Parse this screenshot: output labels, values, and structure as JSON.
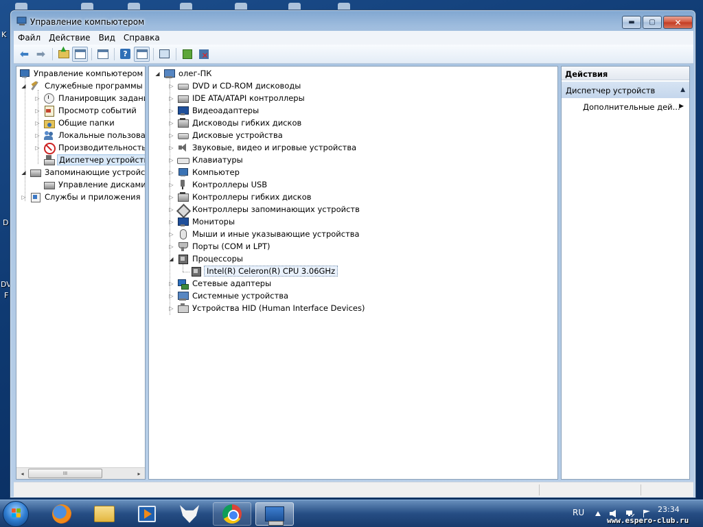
{
  "desktop": {
    "left_edge_labels": [
      "K",
      "D",
      "DV",
      "F"
    ]
  },
  "window": {
    "title": "Управление компьютером",
    "controls": {
      "minimize": "▬",
      "maximize": "▢",
      "close": "✕"
    }
  },
  "menubar": {
    "items": [
      "Файл",
      "Действие",
      "Вид",
      "Справка"
    ]
  },
  "toolbar": {
    "buttons": [
      "back-icon",
      "forward-icon",
      "up-folder-icon",
      "show-hide-tree-icon",
      "properties-icon",
      "help-icon",
      "show-hide-action-pane-icon",
      "scan-hardware-icon",
      "update-driver-icon",
      "uninstall-device-icon"
    ],
    "help_label": "?"
  },
  "left_tree": {
    "items": [
      {
        "label": "Управление компьютером (л",
        "level": 0,
        "expander": "",
        "icon": "computer-management-icon"
      },
      {
        "label": "Служебные программы",
        "level": 1,
        "expander": "◢",
        "icon": "tools-icon"
      },
      {
        "label": "Планировщик заданий",
        "level": 2,
        "expander": "▷",
        "icon": "clock-icon"
      },
      {
        "label": "Просмотр событий",
        "level": 2,
        "expander": "▷",
        "icon": "event-viewer-icon"
      },
      {
        "label": "Общие папки",
        "level": 2,
        "expander": "▷",
        "icon": "shared-folders-icon"
      },
      {
        "label": "Локальные пользовате",
        "level": 2,
        "expander": "▷",
        "icon": "users-icon"
      },
      {
        "label": "Производительность",
        "level": 2,
        "expander": "▷",
        "icon": "performance-icon"
      },
      {
        "label": "Диспетчер устройств",
        "level": 2,
        "expander": "",
        "icon": "device-manager-icon",
        "selected": true
      },
      {
        "label": "Запоминающие устройст",
        "level": 1,
        "expander": "◢",
        "icon": "storage-icon"
      },
      {
        "label": "Управление дисками",
        "level": 2,
        "expander": "",
        "icon": "disk-management-icon"
      },
      {
        "label": "Службы и приложения",
        "level": 1,
        "expander": "▷",
        "icon": "services-icon"
      }
    ],
    "scrollbar_grip": "III",
    "scroll_left": "◂",
    "scroll_right": "▸"
  },
  "device_tree": {
    "root": "олег-ПК",
    "categories": [
      {
        "label": "DVD и CD-ROM дисководы",
        "icon": "dvd-drive-icon",
        "expanded": false
      },
      {
        "label": "IDE ATA/ATAPI контроллеры",
        "icon": "ide-controller-icon",
        "expanded": false
      },
      {
        "label": "Видеоадаптеры",
        "icon": "display-adapter-icon",
        "expanded": false
      },
      {
        "label": "Дисководы гибких дисков",
        "icon": "floppy-drive-icon",
        "expanded": false
      },
      {
        "label": "Дисковые устройства",
        "icon": "disk-drive-icon",
        "expanded": false
      },
      {
        "label": "Звуковые, видео и игровые устройства",
        "icon": "sound-icon",
        "expanded": false
      },
      {
        "label": "Клавиатуры",
        "icon": "keyboard-icon",
        "expanded": false
      },
      {
        "label": "Компьютер",
        "icon": "computer-icon",
        "expanded": false
      },
      {
        "label": "Контроллеры USB",
        "icon": "usb-icon",
        "expanded": false
      },
      {
        "label": "Контроллеры гибких дисков",
        "icon": "floppy-controller-icon",
        "expanded": false
      },
      {
        "label": "Контроллеры запоминающих устройств",
        "icon": "storage-controller-icon",
        "expanded": false
      },
      {
        "label": "Мониторы",
        "icon": "monitor-icon",
        "expanded": false
      },
      {
        "label": "Мыши и иные указывающие устройства",
        "icon": "mouse-icon",
        "expanded": false
      },
      {
        "label": "Порты (COM и LPT)",
        "icon": "port-icon",
        "expanded": false
      },
      {
        "label": "Процессоры",
        "icon": "processor-icon",
        "expanded": true,
        "children": [
          "Intel(R) Celeron(R) CPU 3.06GHz"
        ]
      },
      {
        "label": "Сетевые адаптеры",
        "icon": "network-adapter-icon",
        "expanded": false
      },
      {
        "label": "Системные устройства",
        "icon": "system-devices-icon",
        "expanded": false
      },
      {
        "label": "Устройства HID (Human Interface Devices)",
        "icon": "hid-icon",
        "expanded": false
      }
    ],
    "expander_closed": "▷",
    "expander_open": "◢"
  },
  "actions": {
    "header": "Действия",
    "section": "Диспетчер устройств",
    "section_caret": "▲",
    "more": "Дополнительные дей...",
    "more_caret": "▶"
  },
  "taskbar": {
    "apps": [
      "firefox-icon",
      "explorer-folder-icon",
      "media-player-icon",
      "fox-app-icon",
      "chrome-icon",
      "computer-management-icon"
    ],
    "language": "RU",
    "time": "23:34"
  },
  "watermark": "www.espero-club.ru"
}
